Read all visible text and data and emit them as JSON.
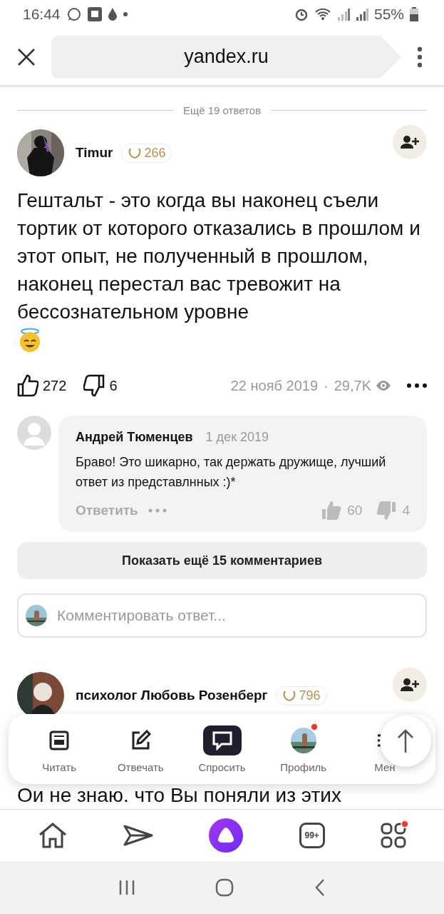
{
  "status_bar": {
    "time": "16:44",
    "battery": "55%"
  },
  "browser": {
    "url": "yandex.ru"
  },
  "more_answers": "Ещё 19 ответов",
  "answer": {
    "author": "Timur",
    "rating": "266",
    "text": "Гештальт - это когда вы наконец съели тортик от которого отказались в прошлом и этот опыт, не полученный в прошлом, наконец перестал вас тревожит на бессознательном уровне",
    "likes": "272",
    "dislikes": "6",
    "date": "22 нояб 2019",
    "separator": "·",
    "views": "29,7K"
  },
  "comment": {
    "author": "Андрей Тюменцев",
    "date": "1 дек 2019",
    "text": "Браво! Это шикарно, так держать дружище, лучший ответ из представлнных :)*",
    "reply": "Ответить",
    "likes": "60",
    "dislikes": "4"
  },
  "show_more": "Показать ещё 15 комментариев",
  "comment_field": {
    "placeholder": "Комментировать ответ..."
  },
  "next_answer": {
    "author": "психолог Любовь Розенберг",
    "rating": "796",
    "text": "Ои не знаю. что Вы поняли из этих"
  },
  "floating_nav": [
    {
      "kind": "read",
      "label": "Читать",
      "selected": false,
      "notification": false
    },
    {
      "kind": "answer",
      "label": "Отвечать",
      "selected": false,
      "notification": false
    },
    {
      "kind": "ask",
      "label": "Спросить",
      "selected": true,
      "notification": false
    },
    {
      "kind": "profile",
      "label": "Профиль",
      "selected": false,
      "notification": true
    },
    {
      "kind": "menu",
      "label": "Мен",
      "selected": false,
      "notification": false
    }
  ],
  "bottom_bar": [
    {
      "kind": "home",
      "notification": false
    },
    {
      "kind": "send",
      "notification": false
    },
    {
      "kind": "alice",
      "notification": false
    },
    {
      "kind": "tabs",
      "count": "99+",
      "notification": false
    },
    {
      "kind": "apps",
      "notification": true
    }
  ]
}
